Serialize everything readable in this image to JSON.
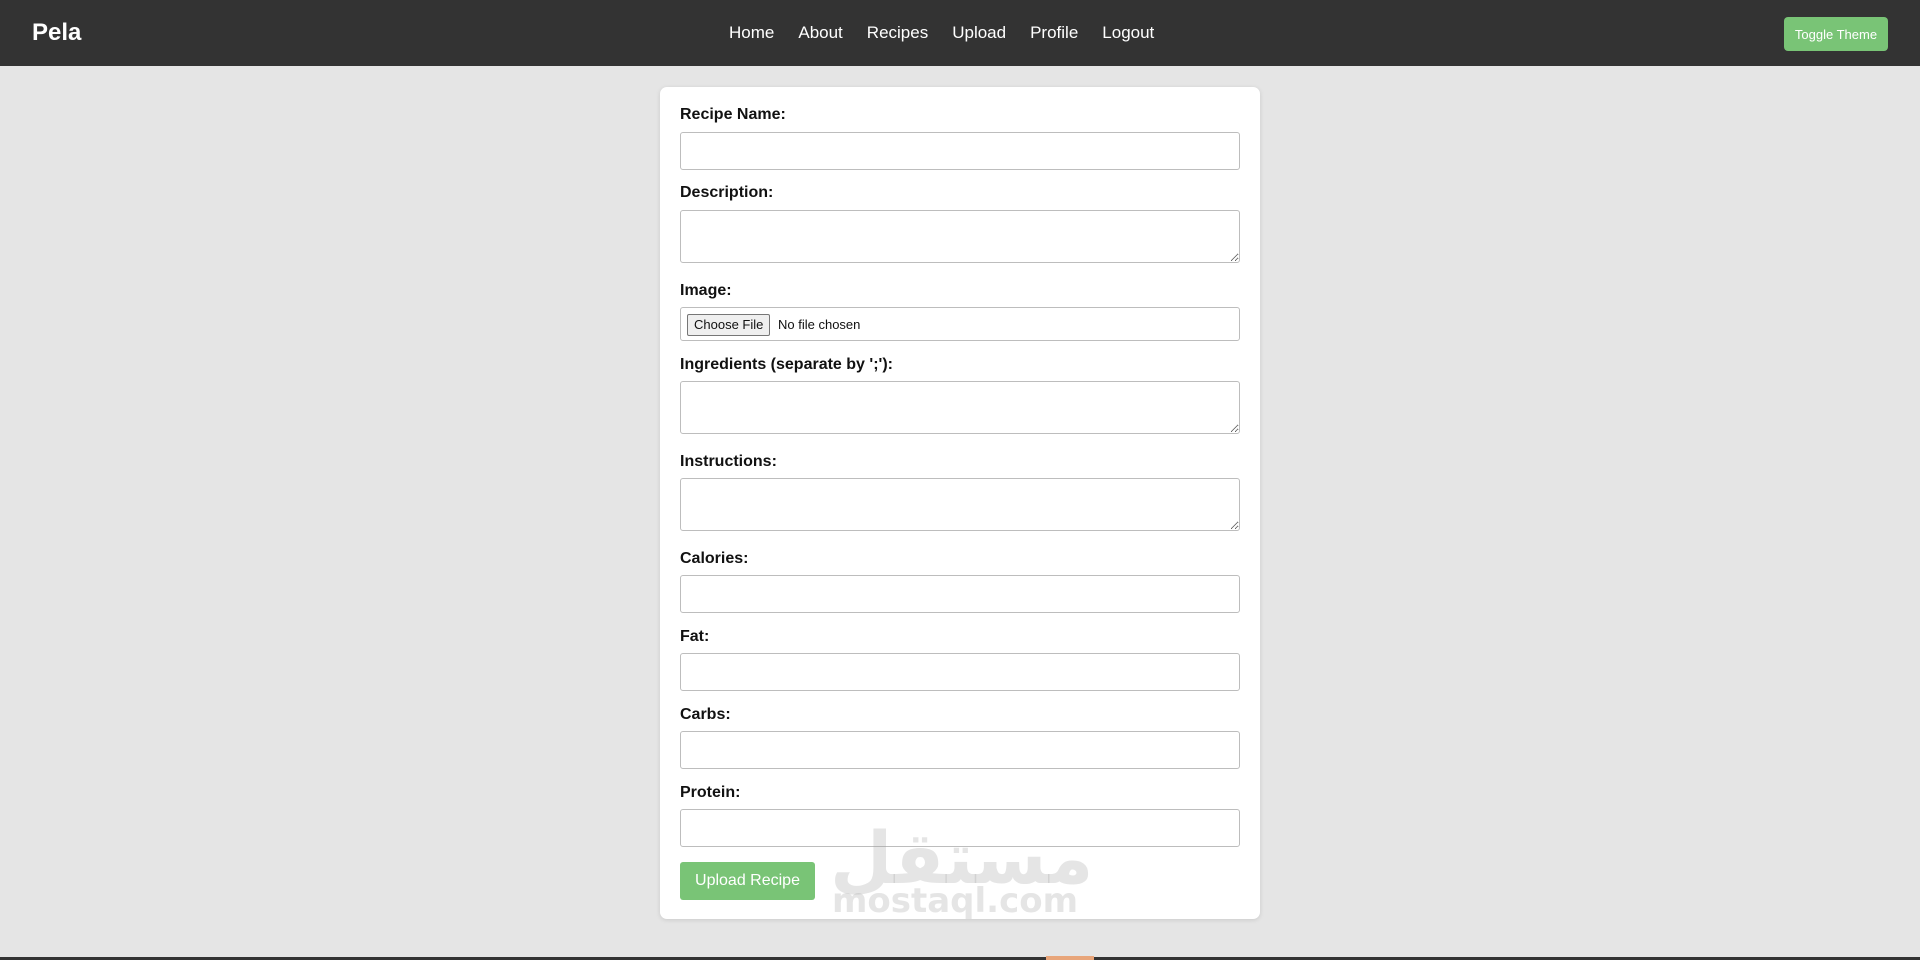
{
  "header": {
    "brand": "Pela",
    "nav": [
      "Home",
      "About",
      "Recipes",
      "Upload",
      "Profile",
      "Logout"
    ],
    "toggle_theme": "Toggle Theme"
  },
  "form": {
    "recipe_name": {
      "label": "Recipe Name:",
      "value": ""
    },
    "description": {
      "label": "Description:",
      "value": ""
    },
    "image": {
      "label": "Image:",
      "button": "Choose File",
      "status": "No file chosen"
    },
    "ingredients": {
      "label": "Ingredients (separate by ';'):",
      "value": ""
    },
    "instructions": {
      "label": "Instructions:",
      "value": ""
    },
    "calories": {
      "label": "Calories:",
      "value": ""
    },
    "fat": {
      "label": "Fat:",
      "value": ""
    },
    "carbs": {
      "label": "Carbs:",
      "value": ""
    },
    "protein": {
      "label": "Protein:",
      "value": ""
    },
    "submit": "Upload Recipe"
  },
  "watermark": {
    "arabic": "مستقل",
    "latin": "mostaql.com"
  },
  "colors": {
    "navbar": "#333333",
    "accent_green": "#79c476",
    "page_background": "#e5e5e5",
    "card_background": "#ffffff"
  }
}
